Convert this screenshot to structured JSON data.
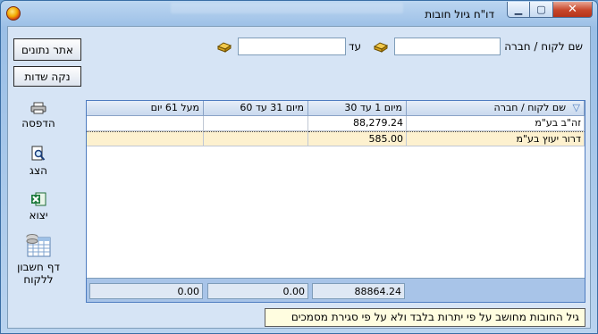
{
  "window": {
    "title": "דו\"ח גיול חובות",
    "minimize_glyph": "▁",
    "maximize_glyph": "▢",
    "close_glyph": "✕"
  },
  "filters": {
    "customer_label": "שם לקוח / חברה",
    "to_label": "עד",
    "from_value": "",
    "to_value": ""
  },
  "buttons": {
    "retrieve": "אתר נתונים",
    "clear": "נקה שדות"
  },
  "grid": {
    "columns": [
      "שם לקוח / חברה",
      "מיום 1 עד 30",
      "מיום 31 עד 60",
      "מעל 61 יום"
    ],
    "sort_glyph": "▽",
    "rows": [
      {
        "name": "זה\"ב בע\"מ",
        "d1_30": "88,279.24",
        "d31_60": "",
        "d61": ""
      },
      {
        "name": "דרור יעוץ בע\"מ",
        "d1_30": "585.00",
        "d31_60": "",
        "d61": ""
      }
    ],
    "totals": {
      "d1_30": "88864.24",
      "d31_60": "0.00",
      "d61": "0.00"
    }
  },
  "sidebar": {
    "print": "הדפסה",
    "preview": "הצג",
    "export": "יצוא",
    "statement": "דף חשבון ללקוח"
  },
  "note": "גיל החובות מחושב על פי יתרות בלבד ולא על פי סגירת מסמכים",
  "colors": {
    "accent": "#4e7cc0",
    "selected_row": "#fdf1cf",
    "note_bg": "#fffde0"
  }
}
